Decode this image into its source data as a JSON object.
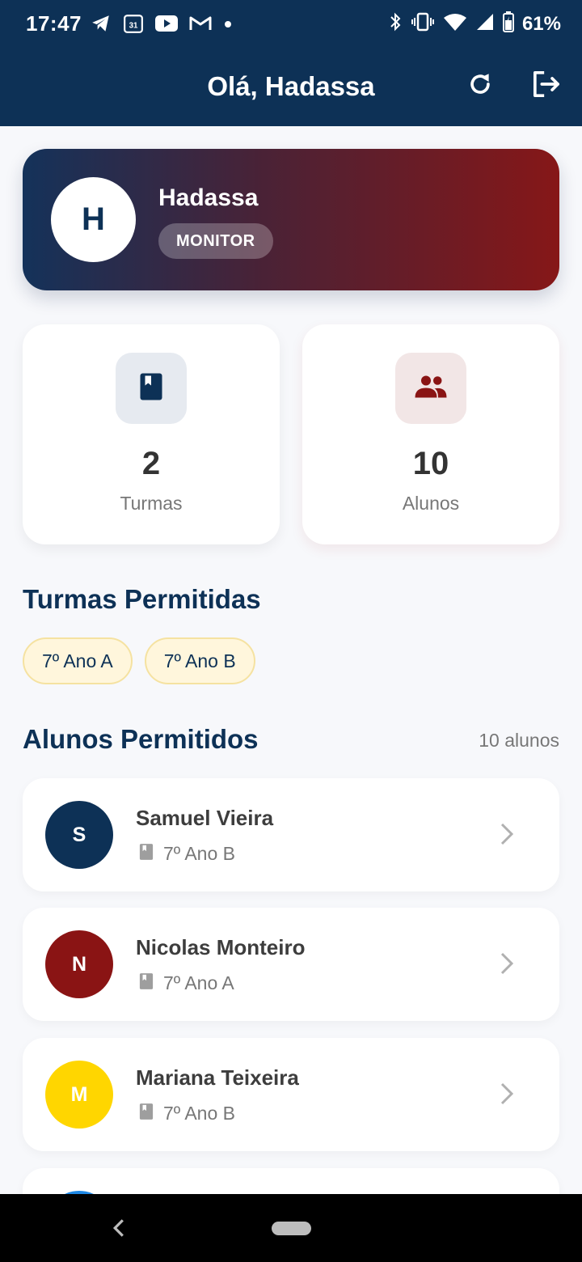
{
  "status_bar": {
    "time": "17:47",
    "battery": "61%",
    "left_icons": [
      "telegram-icon",
      "calendar-icon",
      "youtube-icon",
      "gmail-icon",
      "dot-icon"
    ],
    "calendar_day": "31",
    "right_icons": [
      "bluetooth-icon",
      "vibrate-icon",
      "wifi-icon",
      "signal-icon",
      "battery-icon"
    ]
  },
  "app_bar": {
    "title": "Olá, Hadassa",
    "actions": [
      "refresh-icon",
      "logout-icon"
    ]
  },
  "profile": {
    "initial": "H",
    "name": "Hadassa",
    "role": "MONITOR"
  },
  "stats": [
    {
      "icon": "book-icon",
      "value": "2",
      "label": "Turmas",
      "icon_color": "#0d3156",
      "icon_bg": "#e6eaf0"
    },
    {
      "icon": "people-icon",
      "value": "10",
      "label": "Alunos",
      "icon_color": "#8a1414",
      "icon_bg": "#f2e6e6"
    }
  ],
  "turmas": {
    "title": "Turmas Permitidas",
    "items": [
      "7º Ano A",
      "7º Ano B"
    ]
  },
  "alunos": {
    "title": "Alunos Permitidos",
    "count": "10 alunos",
    "items": [
      {
        "initial": "S",
        "name": "Samuel Vieira",
        "class": "7º Ano B",
        "color": "#0d3156"
      },
      {
        "initial": "N",
        "name": "Nicolas Monteiro",
        "class": "7º Ano A",
        "color": "#8a1414"
      },
      {
        "initial": "M",
        "name": "Mariana Teixeira",
        "class": "7º Ano B",
        "color": "#ffd600"
      }
    ]
  },
  "colors": {
    "primary": "#0d3156",
    "accent": "#8a1414",
    "chip_bg": "#fff6dc"
  }
}
